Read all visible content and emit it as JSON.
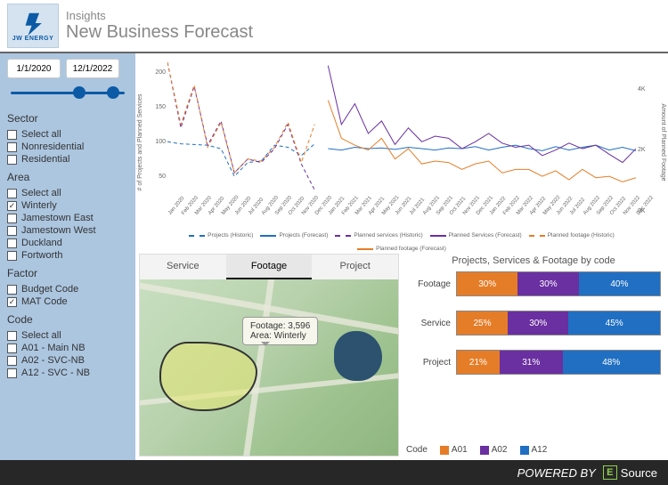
{
  "header": {
    "logo_text": "JW ENERGY",
    "title1": "Insights",
    "title2": "New Business Forecast"
  },
  "dates": {
    "start": "1/1/2020",
    "end": "12/1/2022"
  },
  "sector": {
    "label": "Sector",
    "items": [
      {
        "label": "Select all",
        "checked": false
      },
      {
        "label": "Nonresidential",
        "checked": false
      },
      {
        "label": "Residential",
        "checked": false
      }
    ]
  },
  "area": {
    "label": "Area",
    "items": [
      {
        "label": "Select all",
        "checked": false
      },
      {
        "label": "Winterly",
        "checked": true
      },
      {
        "label": "Jamestown East",
        "checked": false
      },
      {
        "label": "Jamestown West",
        "checked": false
      },
      {
        "label": "Duckland",
        "checked": false
      },
      {
        "label": "Fortworth",
        "checked": false
      }
    ]
  },
  "factor": {
    "label": "Factor",
    "items": [
      {
        "label": "Budget Code",
        "checked": false
      },
      {
        "label": "MAT Code",
        "checked": true
      }
    ]
  },
  "code": {
    "label": "Code",
    "items": [
      {
        "label": "Select all",
        "checked": false
      },
      {
        "label": "A01 - Main NB",
        "checked": false
      },
      {
        "label": "A02 - SVC-NB",
        "checked": false
      },
      {
        "label": "A12 - SVC - NB",
        "checked": false
      }
    ]
  },
  "chart_data": {
    "type": "line",
    "yaxis_left": "# of Projects and Planned Services",
    "yaxis_right": "Amount of Planned Footage",
    "ylim_left": [
      0,
      220
    ],
    "yticks_left": [
      50,
      100,
      150,
      200
    ],
    "ylim_right": [
      0,
      5000
    ],
    "yticks_right": [
      "0K",
      "2K",
      "4K"
    ],
    "x": [
      "Jan 2020",
      "Feb 2020",
      "Mar 2020",
      "Apr 2020",
      "May 2020",
      "Jun 2020",
      "Jul 2020",
      "Aug 2020",
      "Sep 2020",
      "Oct 2020",
      "Nov 2020",
      "Dec 2020",
      "Jan 2021",
      "Feb 2021",
      "Mar 2021",
      "Apr 2021",
      "May 2021",
      "Jun 2021",
      "Jul 2021",
      "Aug 2021",
      "Sep 2021",
      "Oct 2021",
      "Nov 2021",
      "Dec 2021",
      "Jan 2022",
      "Feb 2022",
      "Mar 2022",
      "Apr 2022",
      "May 2022",
      "Jun 2022",
      "Jul 2022",
      "Aug 2022",
      "Sep 2022",
      "Oct 2022",
      "Nov 2022",
      "Dec 2022"
    ],
    "series": [
      {
        "name": "Projects (Historic)",
        "style": "dashed",
        "color": "#206fc2",
        "values": [
          100,
          97,
          96,
          95,
          90,
          50,
          70,
          72,
          95,
          92,
          80,
          97,
          null,
          null,
          null,
          null,
          null,
          null,
          null,
          null,
          null,
          null,
          null,
          null,
          null,
          null,
          null,
          null,
          null,
          null,
          null,
          null,
          null,
          null,
          null,
          null
        ]
      },
      {
        "name": "Projects (Forecast)",
        "style": "solid",
        "color": "#206fc2",
        "values": [
          null,
          null,
          null,
          null,
          null,
          null,
          null,
          null,
          null,
          null,
          null,
          null,
          90,
          88,
          92,
          90,
          91,
          89,
          92,
          90,
          88,
          91,
          90,
          93,
          88,
          92,
          95,
          90,
          87,
          93,
          88,
          92,
          95,
          88,
          92,
          87
        ]
      },
      {
        "name": "Planned services (Historic)",
        "style": "dashed",
        "color": "#6a2fa0",
        "values": [
          215,
          120,
          180,
          95,
          130,
          55,
          75,
          70,
          90,
          125,
          68,
          30,
          null,
          null,
          null,
          null,
          null,
          null,
          null,
          null,
          null,
          null,
          null,
          null,
          null,
          null,
          null,
          null,
          null,
          null,
          null,
          null,
          null,
          null,
          null,
          null
        ]
      },
      {
        "name": "Planned Services (Forecast)",
        "style": "solid",
        "color": "#6a2fa0",
        "values": [
          null,
          null,
          null,
          null,
          null,
          null,
          null,
          null,
          null,
          null,
          null,
          null,
          210,
          125,
          155,
          112,
          130,
          96,
          120,
          100,
          108,
          105,
          90,
          100,
          112,
          98,
          92,
          95,
          80,
          88,
          98,
          90,
          95,
          82,
          70,
          90
        ]
      },
      {
        "name": "Planned footage (Historic)",
        "style": "dashed",
        "color": "#e57d28",
        "values": [
          215,
          125,
          182,
          92,
          128,
          55,
          75,
          72,
          92,
          128,
          70,
          125,
          null,
          null,
          null,
          null,
          null,
          null,
          null,
          null,
          null,
          null,
          null,
          null,
          null,
          null,
          null,
          null,
          null,
          null,
          null,
          null,
          null,
          null,
          null,
          null
        ]
      },
      {
        "name": "Planned footage (Forecast)",
        "style": "solid",
        "color": "#e57d28",
        "values": [
          null,
          null,
          null,
          null,
          null,
          null,
          null,
          null,
          null,
          null,
          null,
          null,
          160,
          105,
          95,
          88,
          105,
          75,
          90,
          68,
          72,
          70,
          60,
          68,
          72,
          55,
          60,
          60,
          50,
          58,
          45,
          60,
          48,
          50,
          42,
          48
        ]
      }
    ],
    "legend": [
      "Projects (Historic)",
      "Projects (Forecast)",
      "Planned services (Historic)",
      "Planned Services (Forecast)",
      "Planned footage (Historic)",
      "Planned footage (Forecast)"
    ]
  },
  "map": {
    "tabs": [
      "Service",
      "Footage",
      "Project"
    ],
    "active_tab": "Footage",
    "tooltip_line1": "Footage:  3,596",
    "tooltip_line2": "Area: Winterly"
  },
  "stacked": {
    "title": "Projects, Services & Footage by code",
    "rows": [
      {
        "label": "Footage",
        "a01": 30,
        "a02": 30,
        "a12": 40
      },
      {
        "label": "Service",
        "a01": 25,
        "a02": 30,
        "a12": 45
      },
      {
        "label": "Project",
        "a01": 21,
        "a02": 31,
        "a12": 48
      }
    ],
    "legend_label": "Code",
    "legend": [
      {
        "name": "A01",
        "color": "#e57d28"
      },
      {
        "name": "A02",
        "color": "#6a2fa0"
      },
      {
        "name": "A12",
        "color": "#206fc2"
      }
    ]
  },
  "footer": {
    "powered": "POWERED BY",
    "brand": "Source"
  }
}
